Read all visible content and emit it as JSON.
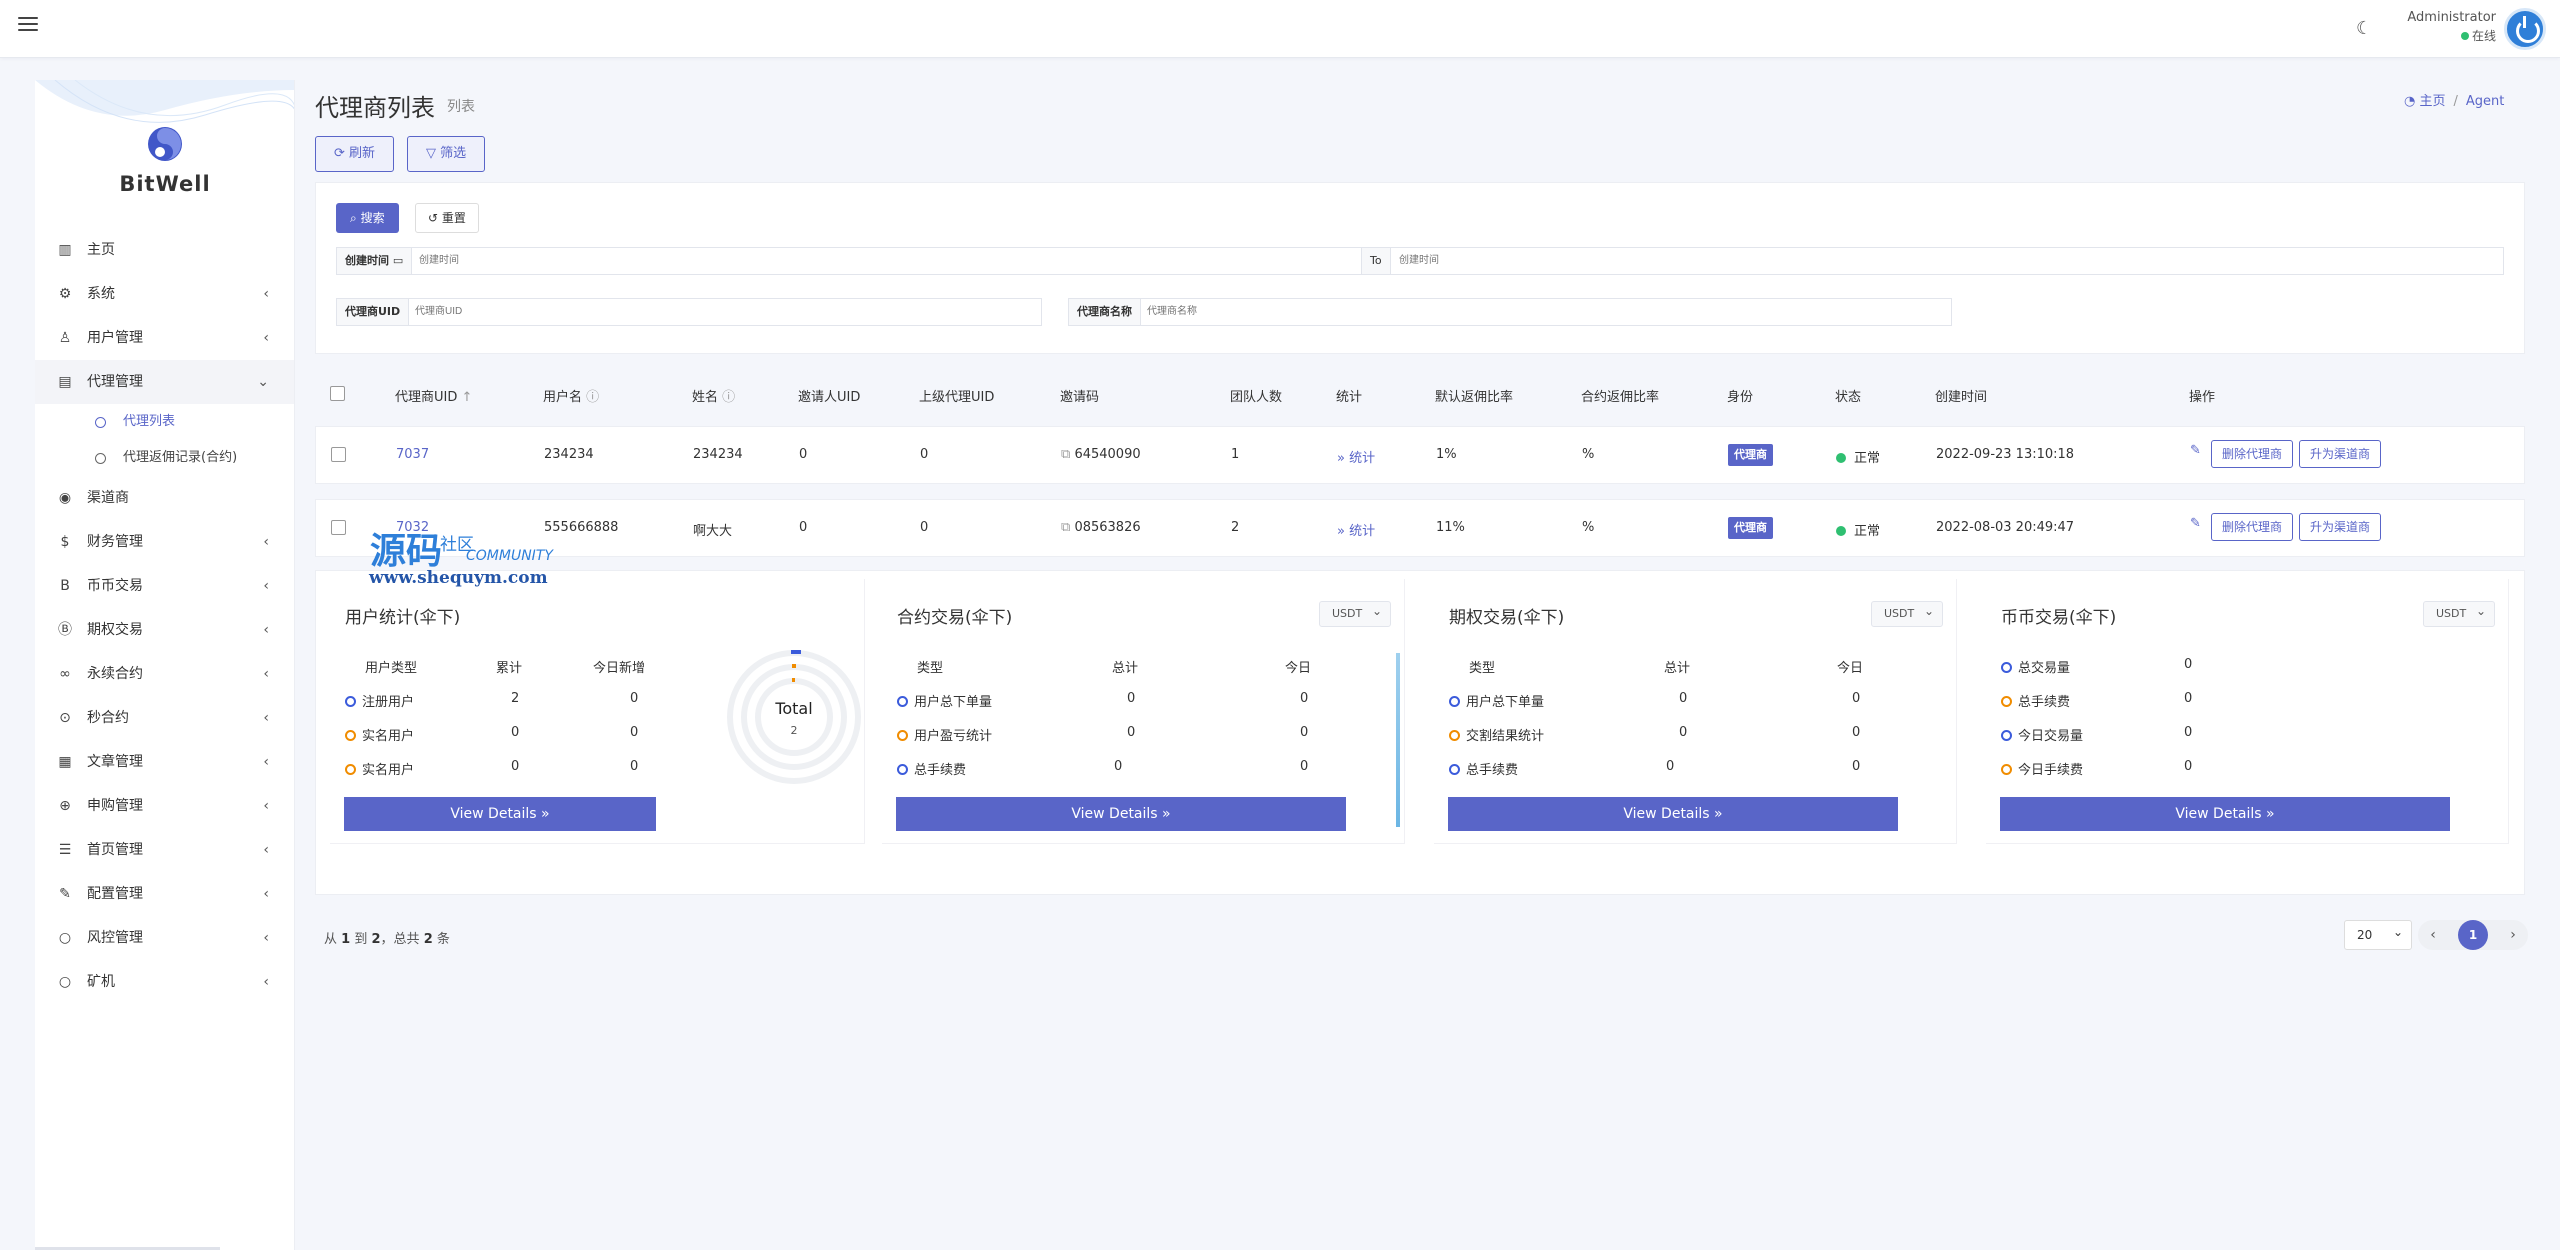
{
  "header": {
    "user_name": "Administrator",
    "user_status": "在线",
    "theme_icon": "moon-icon"
  },
  "sidebar": {
    "brand": "BitWell",
    "items": [
      {
        "label": "主页",
        "icon": "bar-chart-icon",
        "expandable": false
      },
      {
        "label": "系统",
        "icon": "gear-icon",
        "expandable": true
      },
      {
        "label": "用户管理",
        "icon": "user-icon",
        "expandable": true
      },
      {
        "label": "代理管理",
        "icon": "id-card-icon",
        "expandable": true,
        "active": true
      },
      {
        "label": "渠道商",
        "icon": "user-circle-icon",
        "expandable": false
      },
      {
        "label": "财务管理",
        "icon": "dollar-icon",
        "expandable": true
      },
      {
        "label": "币币交易",
        "icon": "bitcoin-icon",
        "expandable": true
      },
      {
        "label": "期权交易",
        "icon": "bitcoin-circle-icon",
        "expandable": true
      },
      {
        "label": "永续合约",
        "icon": "link-icon",
        "expandable": true
      },
      {
        "label": "秒合约",
        "icon": "dot-circle-icon",
        "expandable": true
      },
      {
        "label": "文章管理",
        "icon": "newspaper-icon",
        "expandable": true
      },
      {
        "label": "申购管理",
        "icon": "lifebuoy-icon",
        "expandable": true
      },
      {
        "label": "首页管理",
        "icon": "list-icon",
        "expandable": true
      },
      {
        "label": "配置管理",
        "icon": "wrench-icon",
        "expandable": true
      },
      {
        "label": "风控管理",
        "icon": "circle-icon",
        "expandable": true
      },
      {
        "label": "矿机",
        "icon": "circle-icon",
        "expandable": true
      }
    ],
    "sub_items": [
      {
        "label": "代理列表",
        "active": true
      },
      {
        "label": "代理返佣记录(合约)",
        "active": false
      }
    ]
  },
  "page": {
    "title": "代理商列表",
    "subtitle": "列表",
    "breadcrumb_home": "主页",
    "breadcrumb_current": "Agent",
    "refresh_label": "刷新",
    "filter_label": "筛选"
  },
  "filter": {
    "search_label": "搜索",
    "reset_label": "重置",
    "created_time_label": "创建时间",
    "created_time_placeholder": "创建时间",
    "to_label": "To",
    "created_time_end_placeholder": "创建时间",
    "agent_uid_label": "代理商UID",
    "agent_uid_placeholder": "代理商UID",
    "agent_name_label": "代理商名称",
    "agent_name_placeholder": "代理商名称"
  },
  "table": {
    "headers": [
      "代理商UID",
      "用户名",
      "姓名",
      "邀请人UID",
      "上级代理UID",
      "邀请码",
      "团队人数",
      "统计",
      "默认返佣比率",
      "合约返佣比率",
      "身份",
      "状态",
      "创建时间",
      "操作"
    ],
    "rows": [
      {
        "uid": "7037",
        "username": "234234",
        "name": "234234",
        "inviter_uid": "0",
        "parent_uid": "0",
        "invite_code": "64540090",
        "team": "1",
        "stats": "统计",
        "default_rate": "1%",
        "contract_rate": "%",
        "role": "代理商",
        "status": "正常",
        "created": "2022-09-23 13:10:18",
        "delete_label": "删除代理商",
        "promote_label": "升为渠道商"
      },
      {
        "uid": "7032",
        "username": "555666888",
        "name": "啊大大",
        "inviter_uid": "0",
        "parent_uid": "0",
        "invite_code": "08563826",
        "team": "2",
        "stats": "统计",
        "default_rate": "11%",
        "contract_rate": "%",
        "role": "代理商",
        "status": "正常",
        "created": "2022-08-03 20:49:47",
        "delete_label": "删除代理商",
        "promote_label": "升为渠道商"
      }
    ]
  },
  "cards": {
    "user": {
      "title": "用户统计(伞下)",
      "headers": [
        "用户类型",
        "累计",
        "今日新增"
      ],
      "rows": [
        {
          "label": "注册用户",
          "total": "2",
          "today": "0",
          "color": "#3b5bdb"
        },
        {
          "label": "实名用户",
          "total": "0",
          "today": "0",
          "color": "#f08c00"
        },
        {
          "label": "实名用户",
          "total": "0",
          "today": "0",
          "color": "#f08c00"
        }
      ],
      "donut_label": "Total",
      "donut_value": "2",
      "button": "View Details »"
    },
    "contract": {
      "title": "合约交易(伞下)",
      "currency": "USDT",
      "headers": [
        "类型",
        "总计",
        "今日"
      ],
      "rows": [
        {
          "label": "用户总下单量",
          "total": "0",
          "today": "0",
          "color": "#3b5bdb"
        },
        {
          "label": "用户盈亏统计",
          "total": "0",
          "today": "0",
          "color": "#f08c00"
        },
        {
          "label": "总手续费",
          "total": "0",
          "today": "0",
          "color": "#3b5bdb"
        }
      ],
      "button": "View Details »"
    },
    "option": {
      "title": "期权交易(伞下)",
      "currency": "USDT",
      "headers": [
        "类型",
        "总计",
        "今日"
      ],
      "rows": [
        {
          "label": "用户总下单量",
          "total": "0",
          "today": "0",
          "color": "#3b5bdb"
        },
        {
          "label": "交割结果统计",
          "total": "0",
          "today": "0",
          "color": "#f08c00"
        },
        {
          "label": "总手续费",
          "total": "0",
          "today": "0",
          "color": "#3b5bdb"
        }
      ],
      "button": "View Details »"
    },
    "spot": {
      "title": "币币交易(伞下)",
      "currency": "USDT",
      "rows": [
        {
          "label": "总交易量",
          "value": "0",
          "color": "#3b5bdb"
        },
        {
          "label": "总手续费",
          "value": "0",
          "color": "#f08c00"
        },
        {
          "label": "今日交易量",
          "value": "0",
          "color": "#3b5bdb"
        },
        {
          "label": "今日手续费",
          "value": "0",
          "color": "#f08c00"
        }
      ],
      "button": "View Details »"
    }
  },
  "pagination": {
    "info_prefix": "从",
    "from": "1",
    "info_to": "到",
    "to": "2",
    "info_total": "，总共",
    "total": "2",
    "info_suffix": "条",
    "page_size": "20",
    "current_page": "1"
  },
  "watermark": {
    "line1": "源码",
    "line2": "社区",
    "line3": "COMMUNITY",
    "url": "www.shequym.com"
  },
  "colors": {
    "accent": "#5965c8",
    "success": "#2fbf71"
  }
}
